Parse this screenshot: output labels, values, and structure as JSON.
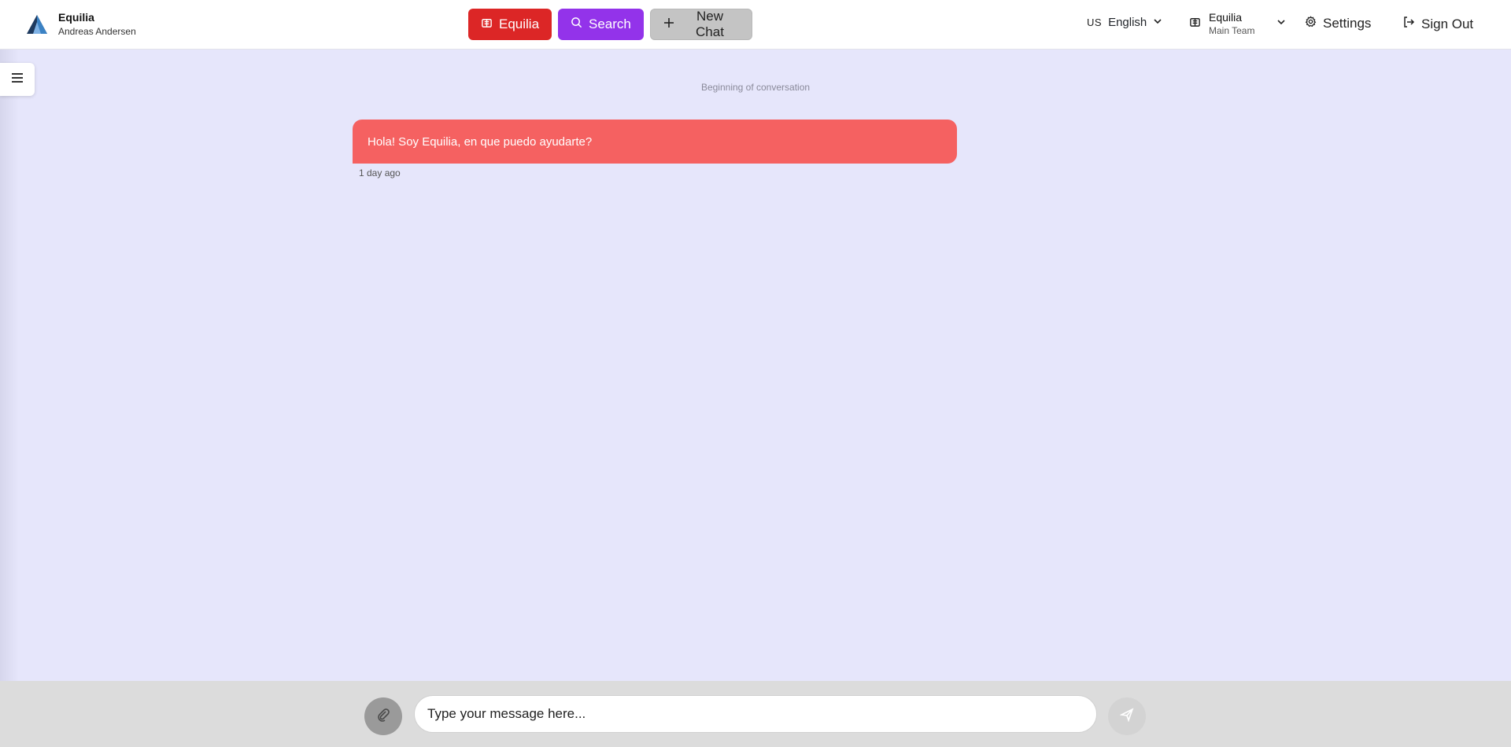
{
  "brand": {
    "title": "Equilia",
    "user": "Andreas Andersen",
    "logo_icon": "mountain-logo-icon"
  },
  "toolbar": {
    "equilia_label": "Equilia",
    "search_label": "Search",
    "new_chat_label": "New Chat"
  },
  "language": {
    "code": "US",
    "label": "English"
  },
  "team": {
    "name": "Equilia",
    "sub": "Main Team"
  },
  "nav": {
    "settings_label": "Settings",
    "signout_label": "Sign Out"
  },
  "conversation": {
    "start_label": "Beginning of conversation",
    "messages": [
      {
        "text": "Hola! Soy Equilia, en que puedo ayudarte?",
        "time": "1 day ago"
      }
    ]
  },
  "composer": {
    "placeholder": "Type your message here..."
  },
  "colors": {
    "equilia_button": "#dc2626",
    "search_button": "#9333ea",
    "new_chat_button": "#c4c4c4",
    "bot_bubble": "#f56161",
    "background": "#e6e6fb"
  }
}
